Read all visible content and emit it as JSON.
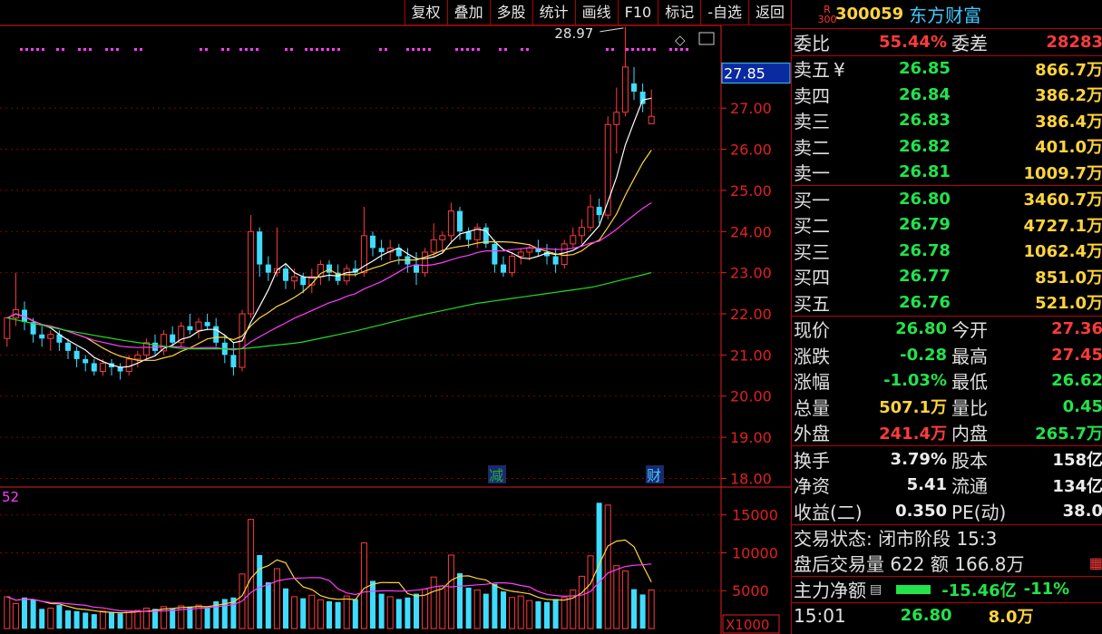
{
  "toolbar": {
    "items": [
      "复权",
      "叠加",
      "多股",
      "统计",
      "画线",
      "F10",
      "标记",
      "-自选",
      "返回"
    ]
  },
  "chart_data": {
    "type": "candlestick",
    "price_axis": {
      "ticks": [
        "27.00",
        "26.00",
        "25.00",
        "24.00",
        "23.00",
        "22.00",
        "21.00",
        "20.00",
        "19.00",
        "18.00"
      ],
      "ylim": [
        17.9,
        28.9
      ]
    },
    "current_price_label": "27.85",
    "high_annotation": "28.97",
    "volume_axis": {
      "ticks": [
        "15000",
        "10000",
        "5000"
      ],
      "unit": "X1000",
      "ylim": [
        0,
        17000
      ]
    },
    "volume_label": "52",
    "event_markers": [
      "减",
      "财"
    ],
    "candles": [
      [
        21.4,
        21.9,
        21.2,
        21.9
      ],
      [
        21.9,
        23.0,
        21.7,
        22.1
      ],
      [
        22.1,
        22.3,
        21.6,
        21.8
      ],
      [
        21.8,
        21.9,
        21.3,
        21.5
      ],
      [
        21.5,
        21.7,
        21.2,
        21.4
      ],
      [
        21.4,
        21.6,
        21.1,
        21.5
      ],
      [
        21.5,
        21.6,
        21.1,
        21.3
      ],
      [
        21.3,
        21.4,
        20.9,
        21.1
      ],
      [
        21.1,
        21.2,
        20.7,
        20.9
      ],
      [
        20.9,
        21.0,
        20.6,
        20.8
      ],
      [
        20.8,
        20.9,
        20.5,
        20.6
      ],
      [
        20.6,
        20.9,
        20.5,
        20.8
      ],
      [
        20.8,
        20.9,
        20.5,
        20.7
      ],
      [
        20.7,
        20.8,
        20.4,
        20.6
      ],
      [
        20.6,
        21.0,
        20.5,
        20.9
      ],
      [
        20.9,
        21.1,
        20.7,
        21.0
      ],
      [
        21.0,
        21.4,
        20.9,
        21.3
      ],
      [
        21.3,
        21.5,
        21.0,
        21.1
      ],
      [
        21.1,
        21.6,
        21.0,
        21.5
      ],
      [
        21.5,
        21.7,
        21.2,
        21.3
      ],
      [
        21.3,
        21.8,
        21.2,
        21.7
      ],
      [
        21.7,
        22.0,
        21.5,
        21.6
      ],
      [
        21.6,
        21.9,
        21.4,
        21.8
      ],
      [
        21.8,
        22.0,
        21.6,
        21.7
      ],
      [
        21.7,
        21.9,
        21.2,
        21.3
      ],
      [
        21.3,
        21.5,
        20.8,
        21.0
      ],
      [
        21.0,
        21.3,
        20.5,
        20.7
      ],
      [
        20.7,
        22.1,
        20.6,
        22.0
      ],
      [
        22.0,
        24.4,
        21.9,
        24.0
      ],
      [
        24.0,
        24.1,
        22.9,
        23.2
      ],
      [
        23.2,
        23.4,
        22.8,
        23.0
      ],
      [
        23.0,
        24.1,
        22.9,
        23.1
      ],
      [
        23.1,
        23.2,
        22.6,
        22.8
      ],
      [
        22.8,
        23.1,
        22.6,
        22.9
      ],
      [
        22.9,
        23.0,
        22.5,
        22.7
      ],
      [
        22.7,
        23.1,
        22.5,
        22.9
      ],
      [
        22.9,
        23.3,
        22.7,
        23.2
      ],
      [
        23.2,
        23.3,
        22.8,
        23.0
      ],
      [
        23.0,
        23.2,
        22.7,
        22.8
      ],
      [
        22.8,
        23.2,
        22.7,
        23.1
      ],
      [
        23.1,
        23.3,
        22.9,
        23.0
      ],
      [
        23.0,
        24.6,
        22.9,
        23.9
      ],
      [
        23.9,
        24.0,
        23.4,
        23.6
      ],
      [
        23.6,
        23.8,
        23.3,
        23.5
      ],
      [
        23.5,
        23.8,
        23.3,
        23.6
      ],
      [
        23.6,
        23.7,
        23.2,
        23.4
      ],
      [
        23.4,
        23.6,
        23.0,
        23.2
      ],
      [
        23.2,
        23.5,
        22.7,
        23.0
      ],
      [
        23.0,
        23.6,
        22.9,
        23.5
      ],
      [
        23.5,
        24.2,
        23.4,
        23.8
      ],
      [
        23.8,
        24.0,
        23.5,
        23.9
      ],
      [
        23.9,
        24.7,
        23.7,
        24.5
      ],
      [
        24.5,
        24.6,
        23.8,
        24.0
      ],
      [
        24.0,
        24.1,
        23.6,
        23.8
      ],
      [
        23.8,
        24.2,
        23.6,
        24.1
      ],
      [
        24.1,
        24.2,
        23.6,
        23.7
      ],
      [
        23.7,
        23.8,
        23.0,
        23.2
      ],
      [
        23.2,
        23.4,
        22.9,
        23.0
      ],
      [
        23.0,
        23.5,
        22.9,
        23.4
      ],
      [
        23.4,
        23.6,
        23.2,
        23.5
      ],
      [
        23.5,
        23.7,
        23.3,
        23.6
      ],
      [
        23.6,
        23.8,
        23.4,
        23.5
      ],
      [
        23.5,
        23.7,
        23.2,
        23.4
      ],
      [
        23.4,
        23.6,
        23.0,
        23.2
      ],
      [
        23.2,
        23.8,
        23.1,
        23.7
      ],
      [
        23.7,
        24.1,
        23.6,
        23.9
      ],
      [
        23.9,
        24.3,
        23.7,
        24.1
      ],
      [
        24.1,
        24.9,
        24.0,
        24.6
      ],
      [
        24.6,
        24.8,
        24.2,
        24.4
      ],
      [
        24.4,
        26.8,
        24.3,
        26.6
      ],
      [
        26.6,
        27.5,
        25.9,
        26.9
      ],
      [
        26.9,
        28.97,
        26.8,
        28.0
      ],
      [
        27.6,
        28.0,
        27.2,
        27.4
      ],
      [
        27.4,
        27.6,
        26.9,
        27.1
      ],
      [
        26.62,
        27.45,
        26.62,
        26.8
      ]
    ],
    "volumes": [
      4200,
      3300,
      4100,
      3800,
      2600,
      2700,
      3100,
      2400,
      2300,
      2100,
      1900,
      2300,
      2100,
      2000,
      2300,
      2400,
      2700,
      2600,
      2900,
      2700,
      3000,
      2900,
      3100,
      2800,
      3600,
      3900,
      4100,
      7200,
      14400,
      9700,
      6100,
      7900,
      5300,
      4200,
      4000,
      4400,
      3800,
      3600,
      3500,
      4300,
      3900,
      11300,
      6300,
      4600,
      4200,
      3900,
      4100,
      4600,
      5200,
      6800,
      5600,
      9700,
      7300,
      5400,
      5100,
      4600,
      5900,
      4900,
      4100,
      4300,
      3700,
      3600,
      3500,
      3900,
      4100,
      5100,
      6900,
      9600,
      16600,
      16300,
      8300,
      7600,
      5200,
      4500,
      5100
    ]
  },
  "header": {
    "badge_top": "R",
    "badge_bottom": "300",
    "code": "300059",
    "name": "东方财富"
  },
  "weibi": {
    "label": "委比",
    "value": "55.44%",
    "label2": "委差",
    "value2": "28283"
  },
  "sell_orders": [
    {
      "label": "卖五",
      "price": "26.85",
      "vol": "866.7万"
    },
    {
      "label": "卖四",
      "price": "26.84",
      "vol": "386.2万"
    },
    {
      "label": "卖三",
      "price": "26.83",
      "vol": "386.4万"
    },
    {
      "label": "卖二",
      "price": "26.82",
      "vol": "401.0万"
    },
    {
      "label": "卖一",
      "price": "26.81",
      "vol": "1009.7万"
    }
  ],
  "sell_currency": "¥",
  "buy_orders": [
    {
      "label": "买一",
      "price": "26.80",
      "vol": "3460.7万"
    },
    {
      "label": "买二",
      "price": "26.79",
      "vol": "4727.1万"
    },
    {
      "label": "买三",
      "price": "26.78",
      "vol": "1062.4万"
    },
    {
      "label": "买四",
      "price": "26.77",
      "vol": "851.0万"
    },
    {
      "label": "买五",
      "price": "26.76",
      "vol": "521.0万"
    }
  ],
  "quote": [
    {
      "l1": "现价",
      "v1": "26.80",
      "c1": "green",
      "l2": "今开",
      "v2": "27.36",
      "c2": "red"
    },
    {
      "l1": "涨跌",
      "v1": "-0.28",
      "c1": "green",
      "l2": "最高",
      "v2": "27.45",
      "c2": "red"
    },
    {
      "l1": "涨幅",
      "v1": "-1.03%",
      "c1": "green",
      "l2": "最低",
      "v2": "26.62",
      "c2": "green"
    },
    {
      "l1": "总量",
      "v1": "507.1万",
      "c1": "yellow",
      "l2": "量比",
      "v2": "0.45",
      "c2": "green"
    },
    {
      "l1": "外盘",
      "v1": "241.4万",
      "c1": "red",
      "l2": "内盘",
      "v2": "265.7万",
      "c2": "green"
    }
  ],
  "fundamentals": [
    {
      "l1": "换手",
      "v1": "3.79%",
      "l2": "股本",
      "v2": "158亿"
    },
    {
      "l1": "净资",
      "v1": "5.41",
      "l2": "流通",
      "v2": "134亿"
    },
    {
      "l1": "收益(二)",
      "v1": "0.350",
      "l2": "PE(动)",
      "v2": "38.0"
    }
  ],
  "status": {
    "trade_state": "交易状态: 闭市阶段 15:3",
    "after_hours": "盘后交易量 622 额 166.8万",
    "main_flow_label": "主力净额",
    "main_flow_value": "-15.46亿",
    "main_flow_pct": "-11%",
    "tick_time": "15:01",
    "tick_price": "26.80",
    "tick_vol": "8.0万"
  },
  "colors": {
    "up": "#ff3b3b",
    "down": "#3fdcff",
    "ma5": "#ffffff",
    "ma10": "#ffd43b",
    "ma20": "#ff3cff",
    "ma60": "#22dd22",
    "grid": "#8b0000",
    "axis": "#e02020"
  }
}
